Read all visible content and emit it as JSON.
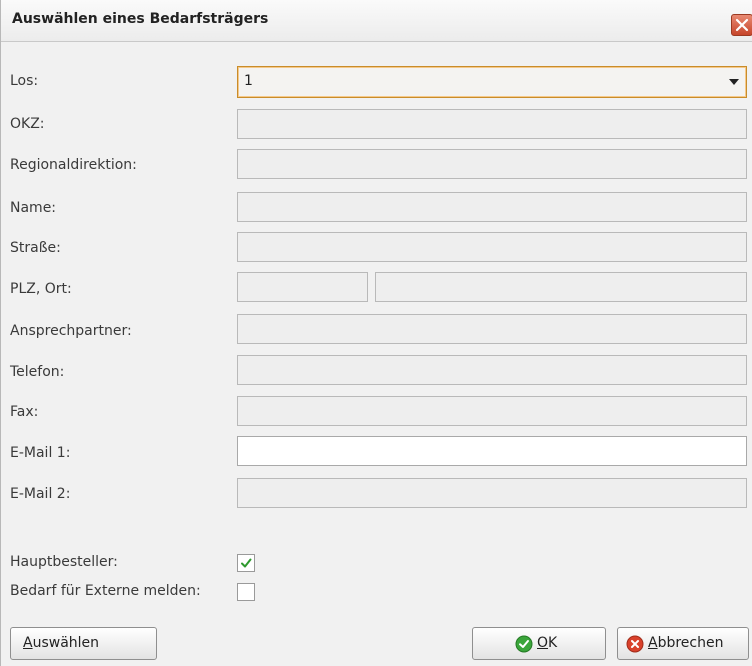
{
  "window": {
    "title": "Auswählen eines Bedarfsträgers"
  },
  "form": {
    "los_label": "Los:",
    "los_value": "1",
    "okz_label": "OKZ:",
    "regionaldirektion_label": "Regionaldirektion:",
    "name_label": "Name:",
    "strasse_label": "Straße:",
    "plz_ort_label": "PLZ, Ort:",
    "ansprechpartner_label": "Ansprechpartner:",
    "telefon_label": "Telefon:",
    "fax_label": "Fax:",
    "email1_label": "E-Mail 1:",
    "email2_label": "E-Mail 2:",
    "hauptbesteller_label": "Hauptbesteller:",
    "hauptbesteller_checked": true,
    "bedarf_extern_label": "Bedarf für Externe melden:",
    "bedarf_extern_checked": false
  },
  "buttons": {
    "select_label_first": "A",
    "select_label_rest": "uswählen",
    "ok_label_first": "O",
    "ok_label_rest": "K",
    "cancel_label_first": "A",
    "cancel_label_rest": "bbrechen"
  },
  "icons": {
    "close": "close-icon",
    "ok": "check-circle-icon",
    "cancel": "x-circle-icon",
    "dropdown": "chevron-down-icon"
  },
  "colors": {
    "focus_border": "#c98c2a",
    "ok_green": "#3aa53a",
    "cancel_red": "#d9412b"
  }
}
